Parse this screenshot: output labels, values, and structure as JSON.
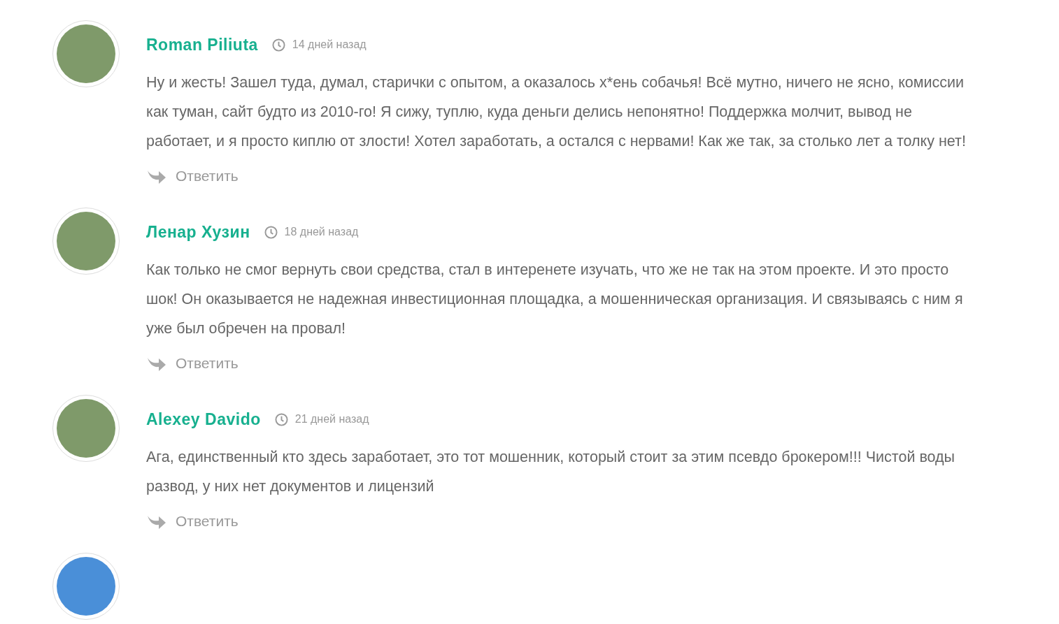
{
  "comments": [
    {
      "author": "Roman Piliuta",
      "time": "14 дней назад",
      "text": "Ну и жесть! Зашел туда, думал, старички с опытом, а оказалось х*ень собачья! Всё мутно, ничего не ясно, комиссии как туман, сайт будто из 2010-го! Я сижу, туплю, куда деньги делись непонятно! Поддержка молчит, вывод не работает, и я просто киплю от злости! Хотел заработать, а остался с нервами! Как же так, за столько лет а толку нет!",
      "reply": "Ответить"
    },
    {
      "author": "Ленар Хузин",
      "time": "18 дней назад",
      "text": "Как только не смог вернуть свои средства, стал в интеренете изучать, что же не так на этом проекте. И это просто шок! Он оказывается не надежная инвестиционная площадка, а мошенническая организация. И связываясь с ним я уже был обречен на провал!",
      "reply": "Ответить"
    },
    {
      "author": "Alexey Davido",
      "time": "21 дней назад",
      "text": "Ага, единственный кто здесь заработает, это тот мошенник, который стоит за этим псевдо брокером!!! Чистой воды развод, у них нет документов и лицензий",
      "reply": "Ответить"
    }
  ]
}
